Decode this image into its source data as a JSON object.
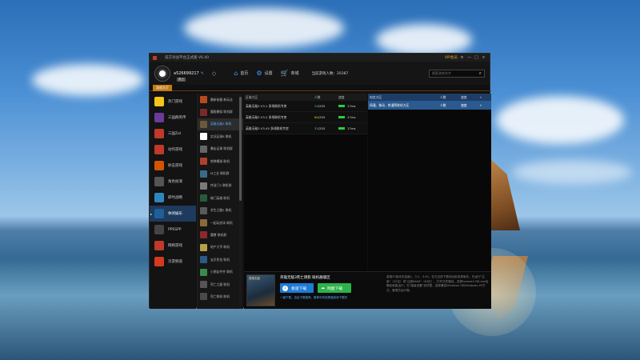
{
  "window": {
    "title": "浩方对战平台正式版 V6.40",
    "vip_label": "VIP会员",
    "controls": [
      "—",
      "□",
      "×"
    ]
  },
  "user": {
    "name": "a526699217",
    "level": "勇士",
    "online_label": "当前游戏人数：20387"
  },
  "nav": [
    {
      "label": "首页",
      "icon": "home-icon"
    },
    {
      "label": "设置",
      "icon": "gear-icon"
    },
    {
      "label": "商城",
      "icon": "cart-icon"
    }
  ],
  "search": {
    "placeholder": "搜索游戏名字"
  },
  "active_tab": "游戏大厅",
  "sidebar": [
    {
      "label": "热门游戏",
      "color": "#f5c518"
    },
    {
      "label": "三国群英传",
      "color": "#6b3b9a"
    },
    {
      "label": "三国Zol",
      "color": "#c0392b"
    },
    {
      "label": "动作游戏",
      "color": "#c0392b"
    },
    {
      "label": "射击游戏",
      "color": "#d35400"
    },
    {
      "label": "角色扮演",
      "color": "#555555"
    },
    {
      "label": "即时战略",
      "color": "#2e86c1"
    },
    {
      "label": "休闲娱乐",
      "color": "#1e5f9a"
    },
    {
      "label": "PPSSPP",
      "color": "#444444"
    },
    {
      "label": "网络游戏",
      "color": "#c0392b"
    },
    {
      "label": "页游频道",
      "color": "#d63a1e"
    }
  ],
  "sidebar_active_index": 7,
  "games": [
    {
      "label": "最新街霸 新玩法",
      "color": "#b84a1e"
    },
    {
      "label": "魔能模拟 联机群",
      "color": "#7a2a2a"
    },
    {
      "label": "英雄无敌3 联机",
      "color": "#6a5a3a"
    },
    {
      "label": "实况足球8 联机",
      "color": "#ffffff"
    },
    {
      "label": "暴走足球 联机群",
      "color": "#666666"
    },
    {
      "label": "炮弹模拟 联机",
      "color": "#b0402a"
    },
    {
      "label": "M工业 联机群",
      "color": "#3a6a8a"
    },
    {
      "label": "传送门2 联机群",
      "color": "#7a7a7a"
    },
    {
      "label": "暗门英雄 联机",
      "color": "#2a5a3a"
    },
    {
      "label": "求生之路2 联机",
      "color": "#5a5a5a"
    },
    {
      "label": "一起玩农场 联机",
      "color": "#8a6a3a"
    },
    {
      "label": "魔兽 联机群",
      "color": "#8a2a2a"
    },
    {
      "label": "地产大亨 联机",
      "color": "#b8a04a"
    },
    {
      "label": "宝贝卧龙 联机",
      "color": "#2a5a8a"
    },
    {
      "label": "小朋友齐齐 联机",
      "color": "#3a8a4a"
    },
    {
      "label": "死亡之屋 联机",
      "color": "#555555"
    },
    {
      "label": "死亡联机 联机",
      "color": "#4a4a4a"
    }
  ],
  "games_active_index": 2,
  "rooms_header": {
    "name": "区域大区",
    "count": "人数",
    "speed": "速度"
  },
  "rooms": [
    {
      "name": "英雄无敌3 V3.1 多线联机专房",
      "count": "29/255",
      "ping": "17ms"
    },
    {
      "name": "英雄无敌3 V3.2 多线联机专房",
      "count": "60/255",
      "ping": "17ms"
    },
    {
      "name": "英雄无敌3 V3.45 多线联机专房",
      "count": "31/255",
      "ping": "17ms"
    }
  ],
  "rooms2_header": {
    "name": "电信大区",
    "count": "人数",
    "speed": "速度",
    "add": "+"
  },
  "rooms2": [
    {
      "name": "网通、移动、铁通等联机大区",
      "count": "人数",
      "speed": "速度",
      "add": "+"
    }
  ],
  "bottom": {
    "cover_text": "英雄无敌",
    "game_name": "英雄无敌3死亡阴影 联机群版区",
    "download_label": "极速下载",
    "netdisk_label": "网盘下载",
    "link_text": "一键下载、自由下载推荐、推荐可有效提速游戏下载机",
    "description": "英雄3T版本包括版1、3.2、3.45。在左边的下载地址前选择版本。先运行\"注册\"（32位）或\"注册64bit\"（64位），打开文件路径，选择heroes3 HD.exe后确定就能运行；在\"高级设置\"选项里，选择兼容Windows 98/Windows XP方式，管理员运行等。"
  }
}
